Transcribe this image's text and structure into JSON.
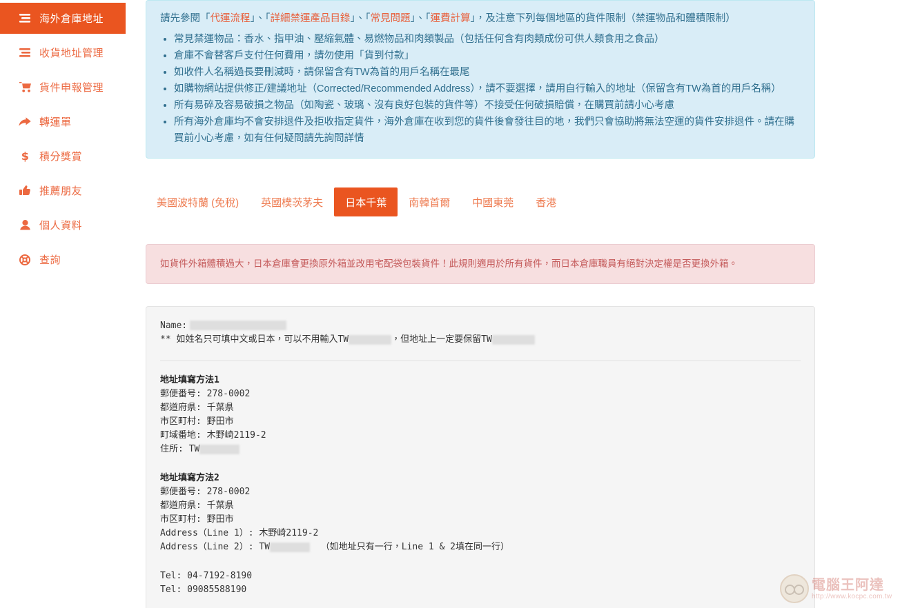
{
  "sidebar": {
    "items": [
      {
        "label": "海外倉庫地址",
        "icon": "list-icon",
        "active": true
      },
      {
        "label": "收貨地址管理",
        "icon": "list-icon",
        "active": false
      },
      {
        "label": "貨件申報管理",
        "icon": "shopping-cart-icon",
        "active": false
      },
      {
        "label": "轉運單",
        "icon": "share-arrow-icon",
        "active": false
      },
      {
        "label": "積分獎賞",
        "icon": "dollar-icon",
        "active": false
      },
      {
        "label": "推薦朋友",
        "icon": "thumbs-up-icon",
        "active": false
      },
      {
        "label": "個人資料",
        "icon": "user-icon",
        "active": false
      },
      {
        "label": "查詢",
        "icon": "life-ring-icon",
        "active": false
      }
    ]
  },
  "info_alert": {
    "lead_parts": [
      "請先參閱「",
      "代運流程",
      "」、「",
      "詳細禁運產品目錄",
      "」、「",
      "常見問題",
      "」、「",
      "運費計算",
      "」，及注意下列每個地區的貨件限制（禁運物品和體積限制）"
    ],
    "links": [
      "代運流程",
      "詳細禁運產品目錄",
      "常見問題",
      "運費計算"
    ],
    "bullets": [
      "常見禁運物品：香水、指甲油、壓縮氣體、易燃物品和肉類製品（包括任何含有肉類成份可供人類食用之食品）",
      "倉庫不會替客戶支付任何費用，請勿使用「貨到付款」",
      "如收件人名稱過長要刪減時，請保留含有TW為首的用戶名稱在最尾",
      "如購物網站提供修正/建議地址（Corrected/Recommended Address），請不要選擇，請用自行輸入的地址（保留含有TW為首的用戶名稱）",
      "所有易碎及容易破損之物品（如陶瓷、玻璃、沒有良好包裝的貨件等）不接受任何破損賠償，在購買前請小心考慮",
      "所有海外倉庫均不會安排退件及拒收指定貨件，海外倉庫在收到您的貨件後會發往目的地，我們只會協助將無法空運的貨件安排退件。請在購買前小心考慮，如有任何疑問請先詢問詳情"
    ]
  },
  "tabs": [
    {
      "label": "美國波特蘭 (免稅)",
      "active": false
    },
    {
      "label": "英國樸茨茅夫",
      "active": false
    },
    {
      "label": "日本千葉",
      "active": true
    },
    {
      "label": "南韓首爾",
      "active": false
    },
    {
      "label": "中國東莞",
      "active": false
    },
    {
      "label": "香港",
      "active": false
    }
  ],
  "danger_alert": {
    "text": "如貨件外箱體積過大，日本倉庫會更換原外箱並改用宅配袋包裝貨件！此規則適用於所有貨件，而日本倉庫職員有絕對決定權是否更換外箱。"
  },
  "address_panel": {
    "name_label": "Name:",
    "name_value": "",
    "note_before": "**  如姓名只可填中文或日本，可以不用輸入TW",
    "note_middle": "，但地址上一定要保留TW",
    "note_after": "",
    "method1": {
      "title": "地址填寫方法1",
      "rows": [
        {
          "label": "郵便番号:",
          "value": "278-0002"
        },
        {
          "label": "都道府県:",
          "value": "千葉県"
        },
        {
          "label": "市区町村:",
          "value": "野田市"
        },
        {
          "label": "町域番地:",
          "value": "木野崎2119-2"
        }
      ],
      "address_label": "住所:",
      "address_prefix": "TW"
    },
    "method2": {
      "title": "地址填寫方法2",
      "rows": [
        {
          "label": "郵便番号:",
          "value": "278-0002"
        },
        {
          "label": "都道府県:",
          "value": "千葉県"
        },
        {
          "label": "市区町村:",
          "value": "野田市"
        },
        {
          "label": "Address（Line 1）:",
          "value": "木野崎2119-2"
        }
      ],
      "line2_label": "Address（Line 2）:",
      "line2_prefix": "TW",
      "line2_note": "（如地址只有一行，Line 1 & 2填在同一行）"
    },
    "tel1": "Tel: 04-7192-8190",
    "tel2": "Tel: 09085588190"
  },
  "watermark": {
    "title": "電腦王阿達",
    "url": "http://www.kocpc.com.tw"
  },
  "colors": {
    "brand_orange": "#ea5520",
    "brand_orange_light": "#ee7b50",
    "info_bg": "#d9edf7",
    "info_border": "#bce8f1",
    "info_text": "#31708f",
    "danger_bg": "#f7dfe0",
    "danger_border": "#ebccd1",
    "danger_text": "#c45a5a",
    "panel_bg": "#f5f5f5"
  }
}
